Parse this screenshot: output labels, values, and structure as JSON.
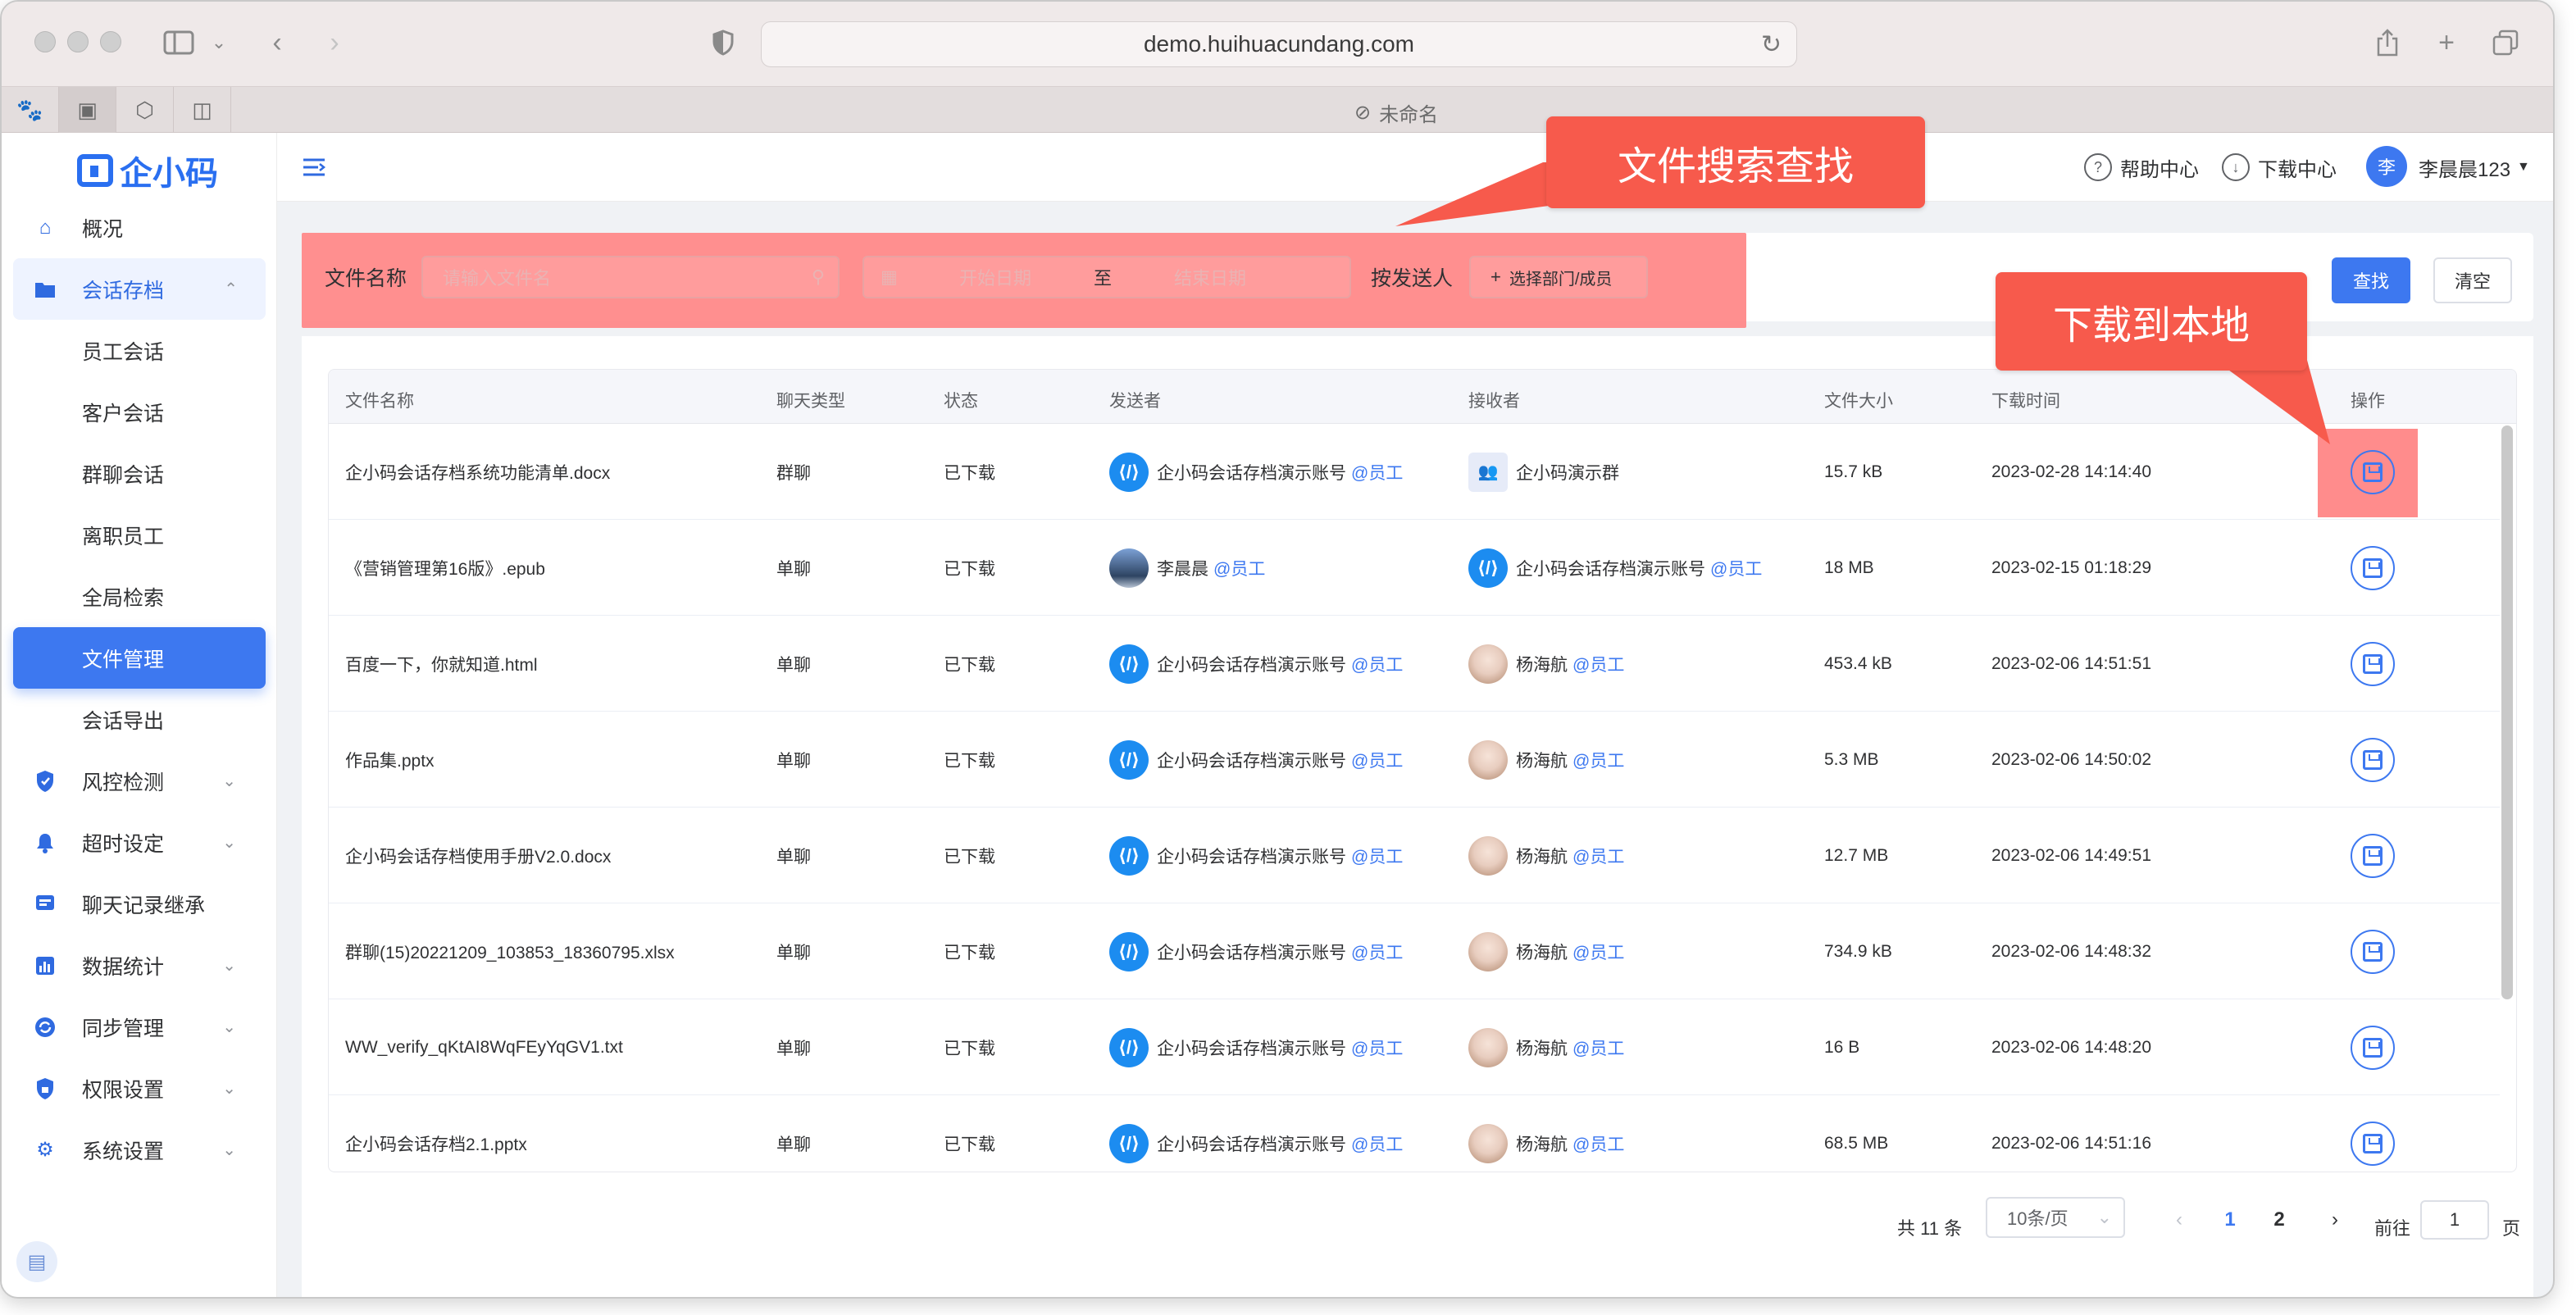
{
  "browser": {
    "url": "demo.huihuacundang.com",
    "tab_title": "未命名"
  },
  "sidebar": {
    "logo_text": "企小码",
    "items": [
      {
        "label": "概况",
        "icon": "home-icon"
      },
      {
        "label": "会话存档",
        "icon": "folder-icon"
      },
      {
        "label": "员工会话"
      },
      {
        "label": "客户会话"
      },
      {
        "label": "群聊会话"
      },
      {
        "label": "离职员工"
      },
      {
        "label": "全局检索"
      },
      {
        "label": "文件管理"
      },
      {
        "label": "会话导出"
      },
      {
        "label": "风控检测",
        "icon": "shield-icon"
      },
      {
        "label": "超时设定",
        "icon": "bell-icon"
      },
      {
        "label": "聊天记录继承",
        "icon": "chat-inherit-icon"
      },
      {
        "label": "数据统计",
        "icon": "bar-chart-icon"
      },
      {
        "label": "同步管理",
        "icon": "sync-icon"
      },
      {
        "label": "权限设置",
        "icon": "lock-shield-icon"
      },
      {
        "label": "系统设置",
        "icon": "gear-icon"
      }
    ]
  },
  "header": {
    "help_label": "帮助中心",
    "download_label": "下载中心",
    "user_avatar": "李",
    "user_name": "李晨晨123"
  },
  "search": {
    "file_name_label": "文件名称",
    "file_name_placeholder": "请输入文件名",
    "start_date_placeholder": "开始日期",
    "range_sep": "至",
    "end_date_placeholder": "结束日期",
    "sender_label": "按发送人",
    "select_member_label": "选择部门/成员",
    "search_button": "查找",
    "clear_button": "清空"
  },
  "callouts": {
    "search_note": "文件搜索查找",
    "download_note": "下载到本地"
  },
  "table": {
    "headers": [
      "文件名称",
      "聊天类型",
      "状态",
      "发送者",
      "接收者",
      "文件大小",
      "下载时间",
      "操作"
    ],
    "rows": [
      {
        "name": "企小码会话存档系统功能清单.docx",
        "type": "群聊",
        "status": "已下载",
        "sender": "企小码会话存档演示账号",
        "sender_tag": "@员工",
        "sender_avatar": "code",
        "receiver": "企小码演示群",
        "receiver_tag": "",
        "receiver_avatar": "group",
        "size": "15.7 kB",
        "time": "2023-02-28 14:14:40"
      },
      {
        "name": "《营销管理第16版》.epub",
        "type": "单聊",
        "status": "已下载",
        "sender": "李晨晨",
        "sender_tag": "@员工",
        "sender_avatar": "photo",
        "receiver": "企小码会话存档演示账号",
        "receiver_tag": "@员工",
        "receiver_avatar": "code",
        "size": "18 MB",
        "time": "2023-02-15 01:18:29"
      },
      {
        "name": "百度一下，你就知道.html",
        "type": "单聊",
        "status": "已下载",
        "sender": "企小码会话存档演示账号",
        "sender_tag": "@员工",
        "sender_avatar": "code",
        "receiver": "杨海航",
        "receiver_tag": "@员工",
        "receiver_avatar": "girl",
        "size": "453.4 kB",
        "time": "2023-02-06 14:51:51"
      },
      {
        "name": "作品集.pptx",
        "type": "单聊",
        "status": "已下载",
        "sender": "企小码会话存档演示账号",
        "sender_tag": "@员工",
        "sender_avatar": "code",
        "receiver": "杨海航",
        "receiver_tag": "@员工",
        "receiver_avatar": "girl",
        "size": "5.3 MB",
        "time": "2023-02-06 14:50:02"
      },
      {
        "name": "企小码会话存档使用手册V2.0.docx",
        "type": "单聊",
        "status": "已下载",
        "sender": "企小码会话存档演示账号",
        "sender_tag": "@员工",
        "sender_avatar": "code",
        "receiver": "杨海航",
        "receiver_tag": "@员工",
        "receiver_avatar": "girl",
        "size": "12.7 MB",
        "time": "2023-02-06 14:49:51"
      },
      {
        "name": "群聊(15)20221209_103853_18360795.xlsx",
        "type": "单聊",
        "status": "已下载",
        "sender": "企小码会话存档演示账号",
        "sender_tag": "@员工",
        "sender_avatar": "code",
        "receiver": "杨海航",
        "receiver_tag": "@员工",
        "receiver_avatar": "girl",
        "size": "734.9 kB",
        "time": "2023-02-06 14:48:32"
      },
      {
        "name": "WW_verify_qKtAI8WqFEyYqGV1.txt",
        "type": "单聊",
        "status": "已下载",
        "sender": "企小码会话存档演示账号",
        "sender_tag": "@员工",
        "sender_avatar": "code",
        "receiver": "杨海航",
        "receiver_tag": "@员工",
        "receiver_avatar": "girl",
        "size": "16 B",
        "time": "2023-02-06 14:48:20"
      },
      {
        "name": "企小码会话存档2.1.pptx",
        "type": "单聊",
        "status": "已下载",
        "sender": "企小码会话存档演示账号",
        "sender_tag": "@员工",
        "sender_avatar": "code",
        "receiver": "杨海航",
        "receiver_tag": "@员工",
        "receiver_avatar": "girl",
        "size": "68.5 MB",
        "time": "2023-02-06 14:51:16"
      }
    ]
  },
  "pagination": {
    "total": "共 11 条",
    "page_size": "10条/页",
    "pages": [
      "1",
      "2"
    ],
    "current_page": "1",
    "goto_prefix": "前往",
    "goto_value": "1",
    "goto_suffix": "页"
  },
  "colors": {
    "primary": "#3d78f0",
    "highlight": "#ff8585",
    "callout": "#f75a4c"
  }
}
